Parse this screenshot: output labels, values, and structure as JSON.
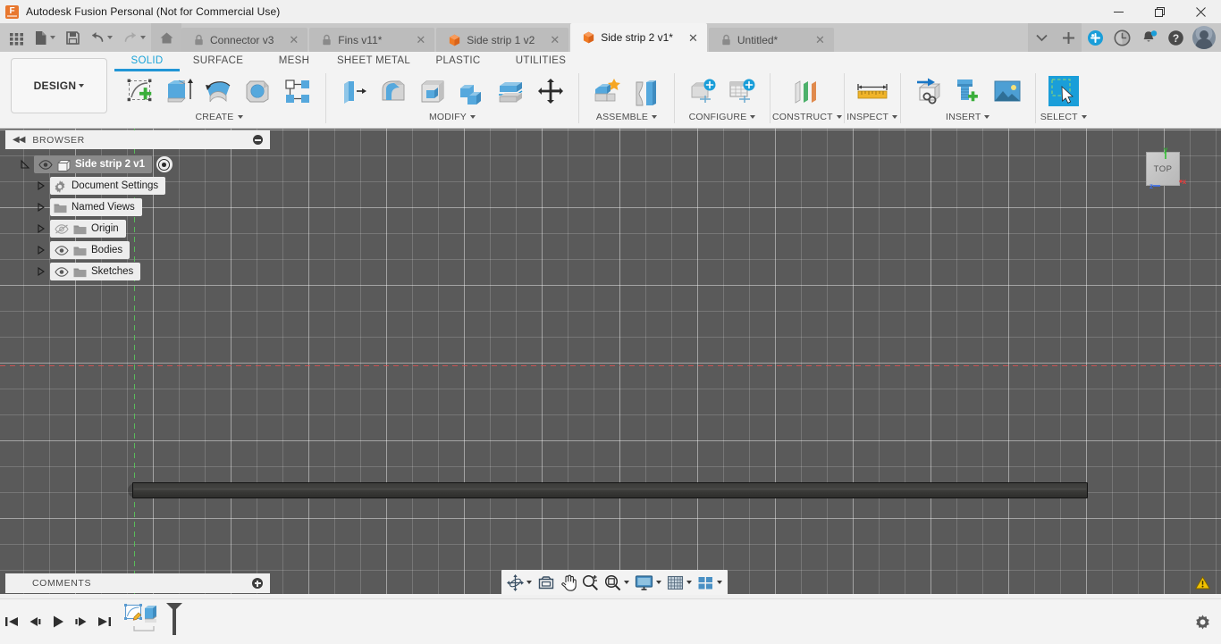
{
  "window": {
    "title": "Autodesk Fusion Personal (Not for Commercial Use)",
    "logo_icon": "fusion-logo-icon",
    "minimize_label": "Minimize",
    "maximize_label": "Restore",
    "close_label": "Close"
  },
  "quick_access": {
    "items": [
      {
        "name": "app-grid-icon",
        "label": "Show Data Panel"
      },
      {
        "name": "new-file-icon",
        "label": "File"
      },
      {
        "name": "save-icon",
        "label": "Save"
      },
      {
        "name": "undo-icon",
        "label": "Undo"
      },
      {
        "name": "redo-icon",
        "label": "Redo"
      },
      {
        "name": "home-icon",
        "label": "Home"
      }
    ]
  },
  "tabs": [
    {
      "label": "Connector v3",
      "icon": "lock-icon",
      "active": false
    },
    {
      "label": "Fins v11*",
      "icon": "lock-icon",
      "active": false
    },
    {
      "label": "Side strip 1 v2",
      "icon": "cube-icon",
      "active": false
    },
    {
      "label": "Side strip 2 v1*",
      "icon": "cube-icon",
      "active": true
    },
    {
      "label": "Untitled*",
      "icon": "lock-icon",
      "active": false
    }
  ],
  "tabstrip_right": {
    "overflow_label": "More tabs",
    "new_tab_label": "New design",
    "extensions_label": "Extensions",
    "job_status_label": "Job status",
    "notifications_label": "Notifications",
    "help_label": "Help",
    "account_label": "Account"
  },
  "ribbon": {
    "workspace": "DESIGN",
    "tabs": [
      {
        "label": "SOLID",
        "active": true
      },
      {
        "label": "SURFACE",
        "active": false
      },
      {
        "label": "MESH",
        "active": false
      },
      {
        "label": "SHEET METAL",
        "active": false
      },
      {
        "label": "PLASTIC",
        "active": false
      },
      {
        "label": "UTILITIES",
        "active": false
      }
    ],
    "groups": [
      {
        "name": "CREATE",
        "has_dropdown": true,
        "tools": [
          {
            "name": "create-sketch-icon",
            "label": "Create Sketch"
          },
          {
            "name": "extrude-icon",
            "label": "Extrude"
          },
          {
            "name": "revolve-icon",
            "label": "Revolve"
          },
          {
            "name": "sweep-icon",
            "label": "Sweep"
          },
          {
            "name": "pattern-icon",
            "label": "Pattern"
          }
        ]
      },
      {
        "name": "MODIFY",
        "has_dropdown": true,
        "tools": [
          {
            "name": "press-pull-icon",
            "label": "Press Pull"
          },
          {
            "name": "fillet-icon",
            "label": "Fillet"
          },
          {
            "name": "shell-icon",
            "label": "Shell"
          },
          {
            "name": "combine-icon",
            "label": "Combine"
          },
          {
            "name": "split-face-icon",
            "label": "Split Face"
          },
          {
            "name": "move-copy-icon",
            "label": "Move/Copy"
          }
        ]
      },
      {
        "name": "ASSEMBLE",
        "has_dropdown": true,
        "tools": [
          {
            "name": "new-component-icon",
            "label": "New Component"
          },
          {
            "name": "joint-icon",
            "label": "Joint"
          }
        ]
      },
      {
        "name": "CONFIGURE",
        "has_dropdown": true,
        "tools": [
          {
            "name": "configuration-icon",
            "label": "Create Configuration"
          },
          {
            "name": "configuration-table-icon",
            "label": "Configuration Table"
          }
        ]
      },
      {
        "name": "CONSTRUCT",
        "has_dropdown": true,
        "tools": [
          {
            "name": "offset-plane-icon",
            "label": "Offset Plane"
          }
        ]
      },
      {
        "name": "INSPECT",
        "has_dropdown": true,
        "tools": [
          {
            "name": "measure-icon",
            "label": "Measure"
          }
        ]
      },
      {
        "name": "INSERT",
        "has_dropdown": true,
        "tools": [
          {
            "name": "insert-derive-icon",
            "label": "Derive"
          },
          {
            "name": "insert-mcmaster-icon",
            "label": "Insert McMaster-Carr Component"
          },
          {
            "name": "insert-canvas-icon",
            "label": "Canvas"
          }
        ]
      },
      {
        "name": "SELECT",
        "has_dropdown": true,
        "tools": [
          {
            "name": "select-icon",
            "label": "Select"
          }
        ]
      }
    ]
  },
  "browser": {
    "header": "BROWSER",
    "collapse_icon": "collapse-left-icon",
    "minimize_icon": "minimize-panel-icon",
    "tree": [
      {
        "label": "Side strip 2 v1",
        "indent": 0,
        "twisty": "open",
        "eye": "visible",
        "icon": "component-icon",
        "root": true,
        "target_icon": "activate-component-icon"
      },
      {
        "label": "Document Settings",
        "indent": 1,
        "twisty": "closed",
        "eye": "none",
        "icon": "gear-icon"
      },
      {
        "label": "Named Views",
        "indent": 1,
        "twisty": "closed",
        "eye": "none",
        "icon": "folder-icon"
      },
      {
        "label": "Origin",
        "indent": 1,
        "twisty": "closed",
        "eye": "hidden",
        "icon": "folder-icon"
      },
      {
        "label": "Bodies",
        "indent": 1,
        "twisty": "closed",
        "eye": "visible",
        "icon": "folder-icon"
      },
      {
        "label": "Sketches",
        "indent": 1,
        "twisty": "closed",
        "eye": "visible",
        "icon": "folder-icon"
      }
    ]
  },
  "comments": {
    "header": "COMMENTS",
    "add_icon": "add-comment-icon"
  },
  "viewport": {
    "viewcube_label": "TOP",
    "axis_x_label": "x",
    "axis_y_label": "y",
    "axis_z_label": "z",
    "colors": {
      "background": "#5a5a5a",
      "axis_x": "#dc5050",
      "axis_y": "#5ac85a",
      "axis_z": "#3a6ff0",
      "body": "#3d3d3b"
    },
    "body_name": "side-strip-body"
  },
  "navbar": {
    "items": [
      {
        "name": "orbit-icon",
        "label": "Orbit",
        "dropdown": true
      },
      {
        "name": "look-at-icon",
        "label": "Look At",
        "dropdown": false
      },
      {
        "name": "pan-icon",
        "label": "Pan",
        "dropdown": false
      },
      {
        "name": "zoom-icon",
        "label": "Zoom",
        "dropdown": false
      },
      {
        "name": "zoom-window-icon",
        "label": "Fit",
        "dropdown": true
      },
      {
        "name": "display-settings-icon",
        "label": "Display Settings",
        "dropdown": true
      },
      {
        "name": "grid-snaps-icon",
        "label": "Grid and Snaps",
        "dropdown": true
      },
      {
        "name": "viewports-icon",
        "label": "Viewports",
        "dropdown": true
      }
    ],
    "warning_icon": "warning-icon"
  },
  "timeline": {
    "controls": [
      {
        "name": "go-to-beginning-icon",
        "label": "Go to beginning"
      },
      {
        "name": "step-back-icon",
        "label": "Step back"
      },
      {
        "name": "play-icon",
        "label": "Play"
      },
      {
        "name": "step-forward-icon",
        "label": "Step forward"
      },
      {
        "name": "go-to-end-icon",
        "label": "Go to end"
      }
    ],
    "features": [
      {
        "name": "sketch-feature-icon",
        "label": "Sketch"
      },
      {
        "name": "extrude-feature-icon",
        "label": "Extrude"
      }
    ],
    "marker_icon": "timeline-marker-icon",
    "settings_icon": "settings-gear-icon"
  },
  "colors": {
    "accent": "#2196d6",
    "ribbon_bg": "#f3f3f3",
    "tabstrip_bg": "#c8c8c8",
    "canvas_bg": "#5a5a5a",
    "warning": "#f2c200",
    "brand_orange": "#e8772e"
  }
}
